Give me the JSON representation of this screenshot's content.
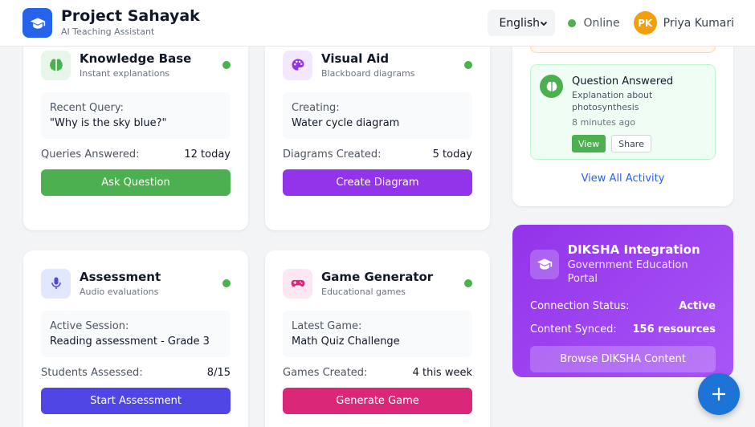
{
  "header": {
    "title": "Project Sahayak",
    "subtitle": "AI Teaching Assistant",
    "language": "English",
    "status": "Online",
    "user_initials": "PK",
    "user_name": "Priya Kumari"
  },
  "tools": [
    {
      "title": "Knowledge Base",
      "subtitle": "Instant explanations",
      "box_label": "Recent Query:",
      "box_value": "\"Why is the sky blue?\"",
      "stat_label": "Queries Answered:",
      "stat_value": "12 today",
      "button": "Ask Question",
      "icon": "brain-icon",
      "color": "#4cb050"
    },
    {
      "title": "Visual Aid",
      "subtitle": "Blackboard diagrams",
      "box_label": "Creating:",
      "box_value": "Water cycle diagram",
      "stat_label": "Diagrams Created:",
      "stat_value": "5 today",
      "button": "Create Diagram",
      "icon": "palette-icon",
      "color": "#9333ea"
    },
    {
      "title": "Assessment",
      "subtitle": "Audio evaluations",
      "box_label": "Active Session:",
      "box_value": "Reading assessment - Grade 3",
      "stat_label": "Students Assessed:",
      "stat_value": "8/15",
      "button": "Start Assessment",
      "icon": "microphone-icon",
      "color": "#4f46e5"
    },
    {
      "title": "Game Generator",
      "subtitle": "Educational games",
      "box_label": "Latest Game:",
      "box_value": "Math Quiz Challenge",
      "stat_label": "Games Created:",
      "stat_value": "4 this week",
      "button": "Generate Game",
      "icon": "gamepad-icon",
      "color": "#db2777"
    }
  ],
  "activity": {
    "item_title": "Question Answered",
    "item_desc": "Explanation about photosynthesis",
    "item_time": "8 minutes ago",
    "view_label": "View",
    "share_label": "Share",
    "view_all": "View All Activity"
  },
  "diksha": {
    "title": "DIKSHA Integration",
    "subtitle": "Government Education Portal",
    "status_label": "Connection Status:",
    "status_value": "Active",
    "synced_label": "Content Synced:",
    "synced_value": "156 resources",
    "button": "Browse DIKSHA Content"
  },
  "fab_icon": "plus-icon"
}
